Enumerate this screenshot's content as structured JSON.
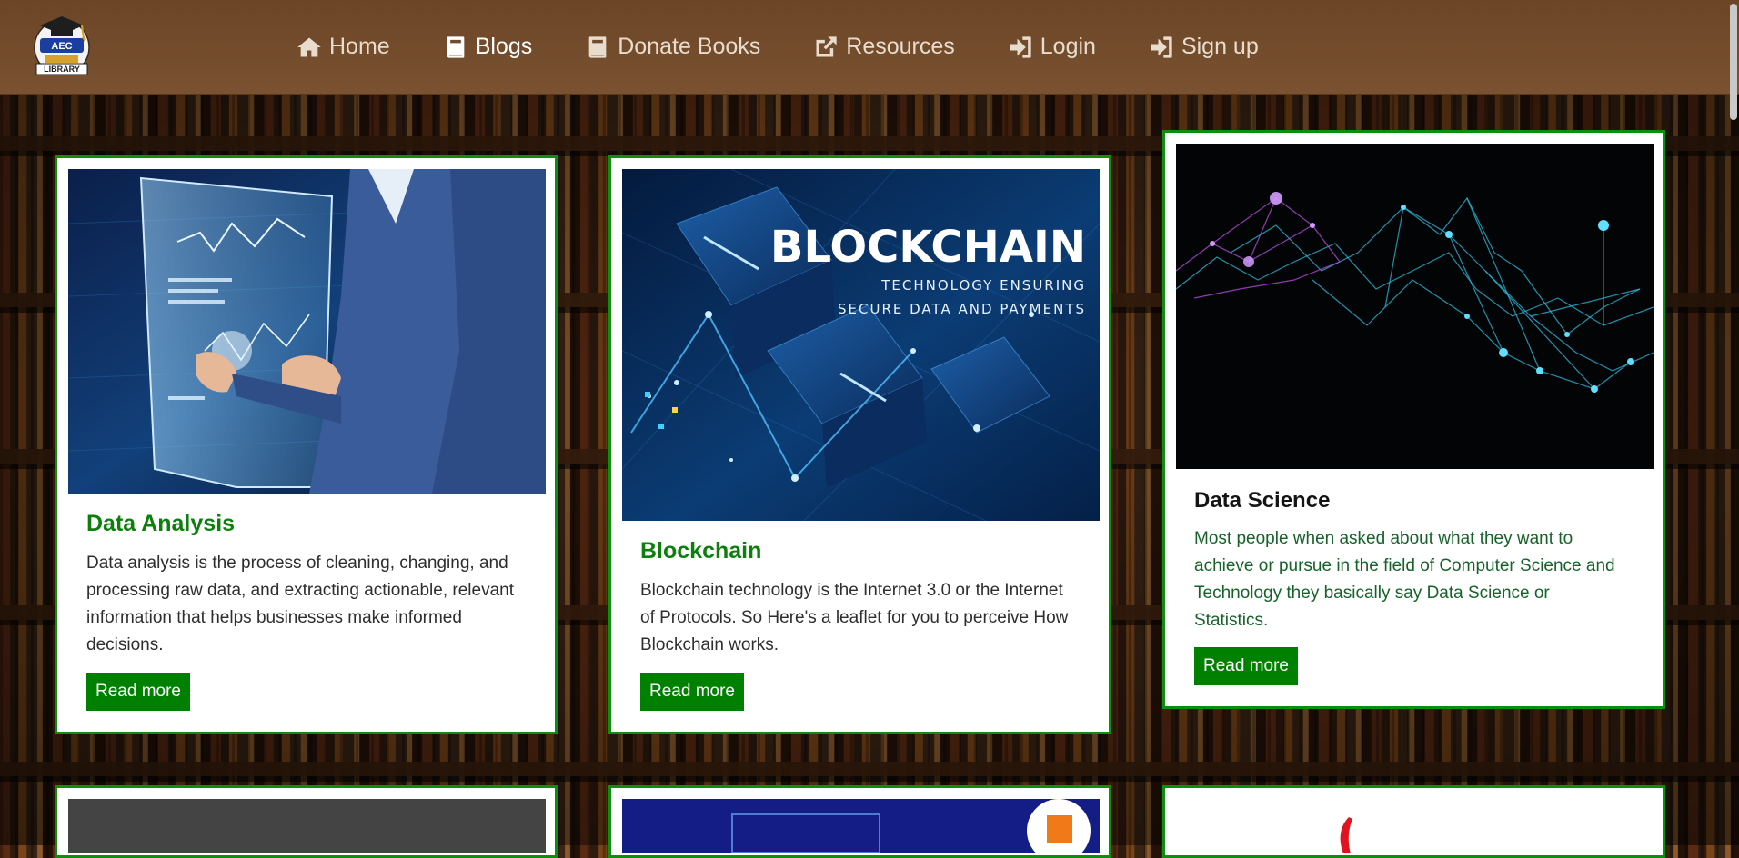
{
  "brand": {
    "logo_top_text": "AEC",
    "logo_bottom_text": "LIBRARY"
  },
  "nav": {
    "items": [
      {
        "label": "Home",
        "icon": "home-icon",
        "active": false
      },
      {
        "label": "Blogs",
        "icon": "book-icon",
        "active": true
      },
      {
        "label": "Donate Books",
        "icon": "book-icon",
        "active": false
      },
      {
        "label": "Resources",
        "icon": "external-link-icon",
        "active": false
      },
      {
        "label": "Login",
        "icon": "sign-in-icon",
        "active": false
      },
      {
        "label": "Sign up",
        "icon": "sign-in-icon",
        "active": false
      }
    ]
  },
  "cards": [
    {
      "title": "Data Analysis",
      "text": "Data analysis is the process of cleaning, changing, and processing raw data, and extracting actionable, relevant information that helps businesses make informed decisions.",
      "button": "Read more"
    },
    {
      "title": "Blockchain",
      "text": "Blockchain technology is the Internet 3.0 or the Internet of Protocols. So Here's a leaflet for you to perceive How Blockchain works.",
      "button": "Read more",
      "image_heading": "BLOCKCHAIN",
      "image_sub_1": "TECHNOLOGY ENSURING",
      "image_sub_2": "SECURE DATA AND PAYMENTS"
    },
    {
      "title": "Data Science",
      "text": "Most people when asked about what they want to achieve or pursue in the field of Computer Science and Technology they basically say Data Science or Statistics.",
      "button": "Read more"
    }
  ],
  "colors": {
    "navbar": "#6b4526",
    "card_border": "#0d8f0d",
    "button": "#008000",
    "title_green": "#0c7f0c"
  }
}
